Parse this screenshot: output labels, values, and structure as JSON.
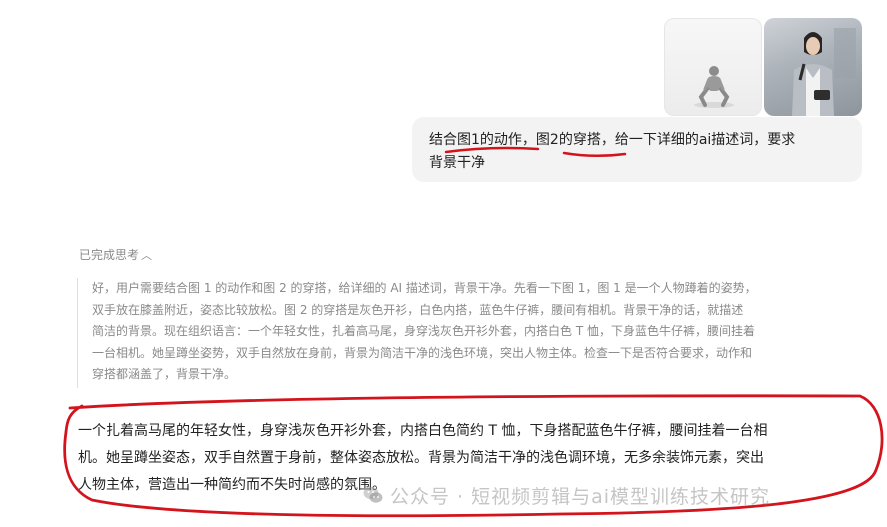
{
  "attachments": [
    {
      "icon": "crouching-figure-image"
    },
    {
      "icon": "woman-with-camera-image"
    }
  ],
  "user_message": {
    "lines": [
      "结合图1的动作，图2的穿搭，给一下详细的ai描述词，要求",
      "背景干净"
    ]
  },
  "thinking": {
    "toggle_label": "已完成思考",
    "lines": [
      "好，用户需要结合图 1 的动作和图 2 的穿搭，给详细的 AI 描述词，背景干净。先看一下图 1，图 1 是一个人物蹲着的姿势，",
      "双手放在膝盖附近，姿态比较放松。图 2 的穿搭是灰色开衫，白色内搭，蓝色牛仔裤，腰间有相机。背景干净的话，就描述",
      "简洁的背景。现在组织语言：一个年轻女性，扎着高马尾，身穿浅灰色开衫外套，内搭白色 T 恤，下身蓝色牛仔裤，腰间挂着",
      "一台相机。她呈蹲坐姿势，双手自然放在身前，背景为简洁干净的浅色环境，突出人物主体。检查一下是否符合要求，动作和",
      "穿搭都涵盖了，背景干净。"
    ]
  },
  "answer": {
    "lines": [
      "一个扎着高马尾的年轻女性，身穿浅灰色开衫外套，内搭白色简约 T 恤，下身搭配蓝色牛仔裤，腰间挂着一台相",
      "机。她呈蹲坐姿态，双手自然置于身前，整体姿态放松。背景为简洁干净的浅色调环境，无多余装饰元素，突出",
      "人物主体，营造出一种简约而不失时尚感的氛围。"
    ]
  },
  "watermark": {
    "text": "公众号 · 短视频剪辑与ai模型训练技术研究",
    "icon": "wechat-icon"
  },
  "colors": {
    "annotation": "#d3141c",
    "bubble_bg": "#f3f3f3",
    "muted_text": "#8a8a8a"
  }
}
